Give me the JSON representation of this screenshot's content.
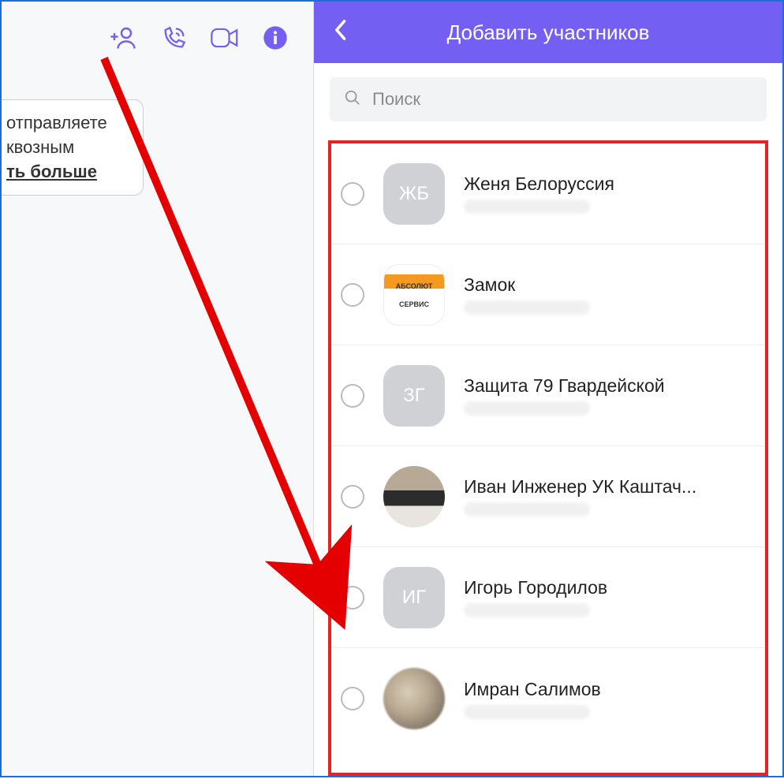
{
  "colors": {
    "accent": "#7360f2",
    "highlight": "#e62222"
  },
  "left": {
    "msg_line1": "отправляете",
    "msg_line2": "квозным",
    "msg_link": "ть больше"
  },
  "header": {
    "title": "Добавить участников"
  },
  "search": {
    "placeholder": "Поиск"
  },
  "contacts": [
    {
      "name": "Женя Белоруссия",
      "avatar_type": "initials",
      "initials": "ЖБ"
    },
    {
      "name": "Замок",
      "avatar_type": "logo",
      "logo_line1": "АБСОЛЮТ",
      "logo_line2": "СЕРВИС"
    },
    {
      "name": "Защита 79 Гвардейской",
      "avatar_type": "initials",
      "initials": "ЗГ"
    },
    {
      "name": "Иван Инженер УК Каштач...",
      "avatar_type": "photo"
    },
    {
      "name": "Игорь Городилов",
      "avatar_type": "initials",
      "initials": "ИГ"
    },
    {
      "name": "Имран Салимов",
      "avatar_type": "blur"
    }
  ]
}
